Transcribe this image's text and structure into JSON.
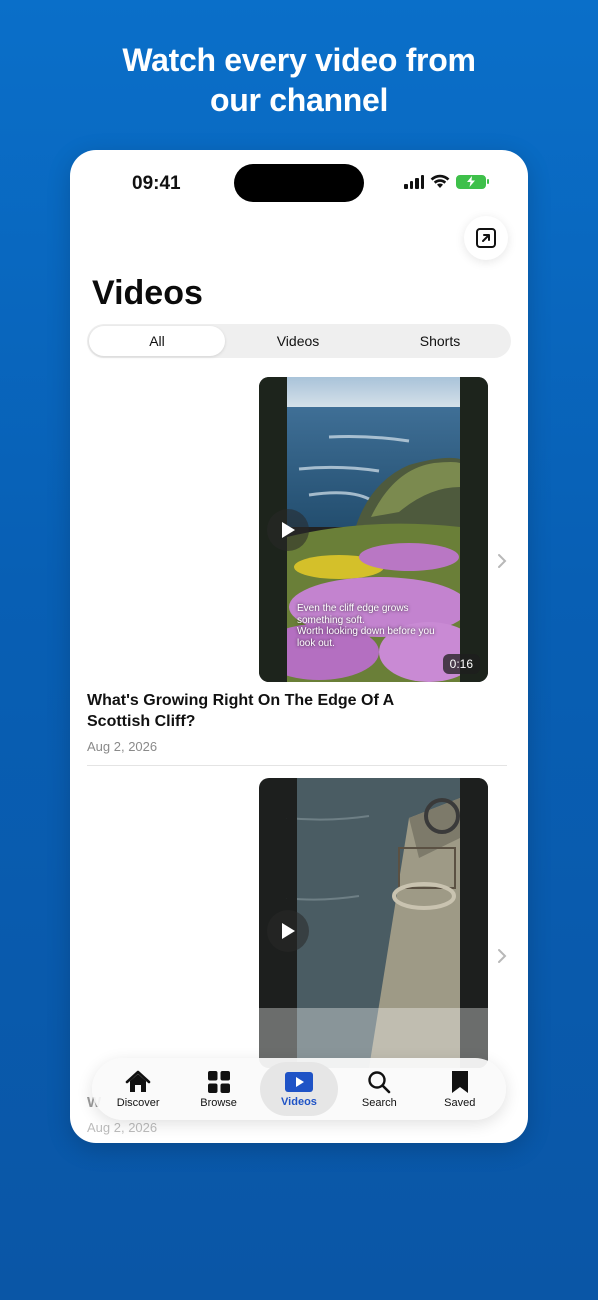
{
  "headline": {
    "line1": "Watch every video from",
    "line2": "our channel"
  },
  "status_bar": {
    "time": "09:41"
  },
  "page": {
    "title": "Videos"
  },
  "segments": [
    "All",
    "Videos",
    "Shorts"
  ],
  "selected_segment": "All",
  "videos": [
    {
      "caption": [
        "Even the cliff edge grows",
        "something soft.",
        "Worth looking down before you",
        "look out."
      ],
      "duration": "0:16",
      "title_line1": "What's Growing Right On The Edge Of A",
      "title_line2": "Scottish Cliff?",
      "date": "Aug 2, 2026"
    },
    {
      "title_fragment": "W",
      "date": "Aug 2, 2026"
    }
  ],
  "tabbar": {
    "items": [
      {
        "label": "Discover",
        "icon": "house-icon"
      },
      {
        "label": "Browse",
        "icon": "grid-icon"
      },
      {
        "label": "Videos",
        "icon": "play-icon"
      },
      {
        "label": "Search",
        "icon": "search-icon"
      },
      {
        "label": "Saved",
        "icon": "bookmark-icon"
      }
    ],
    "active": "Videos"
  },
  "colors": {
    "background": "#0a6fc9",
    "accent": "#1f53c6",
    "battery": "#3ec04a"
  }
}
